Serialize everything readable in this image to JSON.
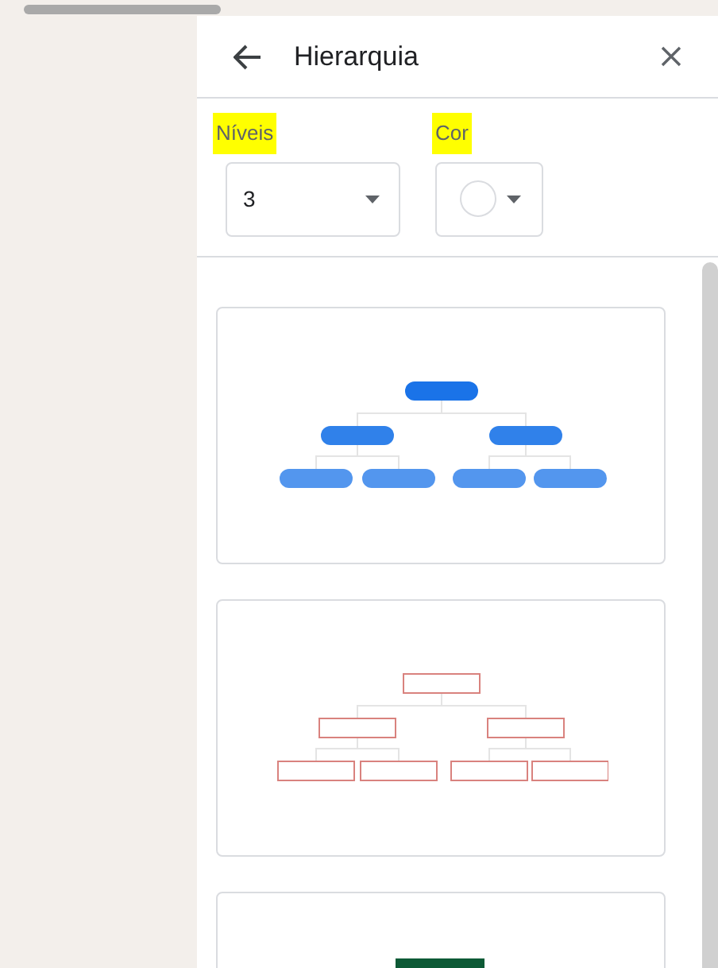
{
  "panel": {
    "title": "Hierarquia"
  },
  "controls": [
    {
      "kind": "select",
      "label": "Níveis",
      "value": "3"
    },
    {
      "kind": "color",
      "label": "Cor"
    }
  ],
  "templates": [
    {
      "kind": "pill-tree",
      "color": "#1a73e8"
    },
    {
      "kind": "box-tree",
      "color": "#d9827e"
    },
    {
      "kind": "block",
      "color": "#0d5a36"
    }
  ]
}
